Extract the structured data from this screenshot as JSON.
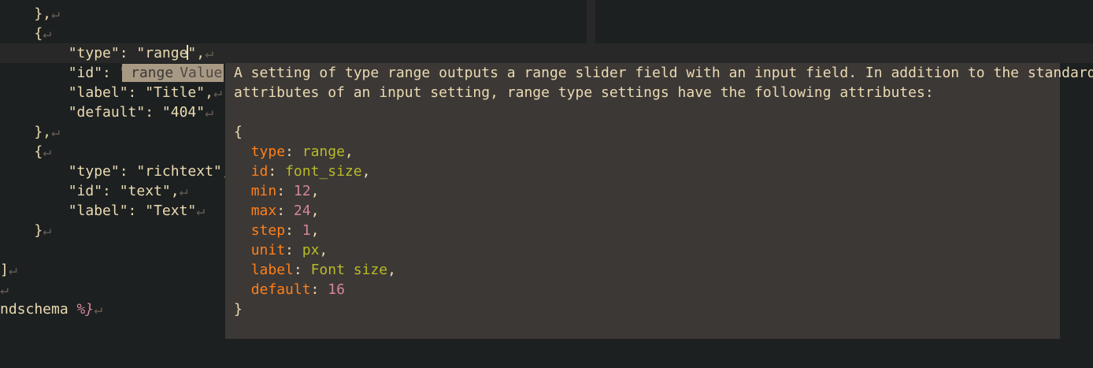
{
  "editor": {
    "lines": [
      {
        "text": "    },",
        "eol": "↵"
      },
      {
        "text": "    {",
        "eol": "↵"
      },
      {
        "text_before": "        \"type\": \"range",
        "text_after": "\",",
        "eol": "↵"
      },
      {
        "text": "        \"id\": \"t"
      },
      {
        "text": "        \"label\": \"Title\",",
        "eol": "↵"
      },
      {
        "text": "        \"default\": \"404\"",
        "eol": "↵"
      },
      {
        "text": "    },",
        "eol": "↵"
      },
      {
        "text": "    {",
        "eol": "↵"
      },
      {
        "text": "        \"type\": \"richtext\",",
        "eol": "↵"
      },
      {
        "text": "        \"id\": \"text\",",
        "eol": "↵"
      },
      {
        "text": "        \"label\": \"Text\"",
        "eol": "↵"
      },
      {
        "text": "    }",
        "eol": "↵"
      },
      {
        "text": "",
        "eol": ""
      },
      {
        "text": "]",
        "eol": "↵"
      },
      {
        "text": "",
        "eol": "↵"
      },
      {
        "text_before": "ndschema ",
        "tag": "%}",
        "eol": "↵"
      }
    ]
  },
  "completion": {
    "item": "range",
    "kind": "Value"
  },
  "doc": {
    "line1": "A setting of type range outputs a range slider field with an input field. In addition to the standard",
    "line2": "attributes of an input setting, range type settings have the following attributes:",
    "open": "{",
    "close": "}",
    "attributes": [
      {
        "key": "type",
        "value": "range",
        "kind": "s",
        "comma": ","
      },
      {
        "key": "id",
        "value": "font_size",
        "kind": "s",
        "comma": ","
      },
      {
        "key": "min",
        "value": "12",
        "kind": "n",
        "comma": ","
      },
      {
        "key": "max",
        "value": "24",
        "kind": "n",
        "comma": ","
      },
      {
        "key": "step",
        "value": "1",
        "kind": "n",
        "comma": ","
      },
      {
        "key": "unit",
        "value": "px",
        "kind": "s",
        "comma": ","
      },
      {
        "key": "label",
        "value": "Font size",
        "kind": "s",
        "comma": ","
      },
      {
        "key": "default",
        "value": "16",
        "kind": "n",
        "comma": ""
      }
    ]
  },
  "colors": {
    "background": "#1d2021",
    "popup_background": "#3c3836",
    "completion_background": "#a89984",
    "key": "#fe8019",
    "string": "#b8bb26",
    "number": "#d3869b"
  }
}
